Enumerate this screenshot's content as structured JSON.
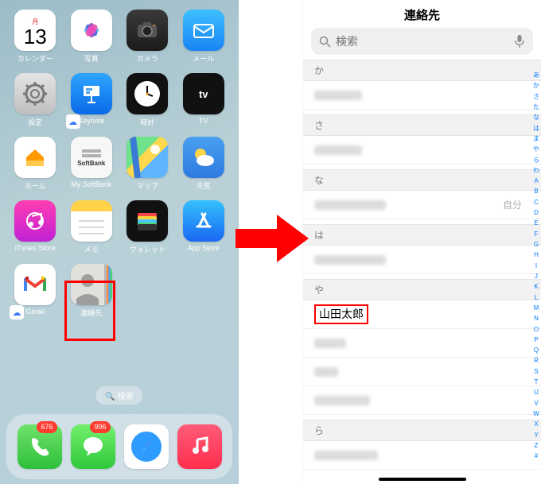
{
  "home": {
    "calendar": {
      "dow": "月",
      "day": "13"
    },
    "apps": [
      {
        "key": "calendar",
        "label": "カレンダー"
      },
      {
        "key": "photos",
        "label": "写真"
      },
      {
        "key": "camera",
        "label": "カメラ"
      },
      {
        "key": "mail",
        "label": "メール"
      },
      {
        "key": "settings",
        "label": "設定"
      },
      {
        "key": "keynote",
        "label": "Keynote"
      },
      {
        "key": "clock",
        "label": "時計"
      },
      {
        "key": "tv",
        "label": "TV"
      },
      {
        "key": "homeapp",
        "label": "ホーム"
      },
      {
        "key": "softbank",
        "label": "My SoftBank"
      },
      {
        "key": "maps",
        "label": "マップ"
      },
      {
        "key": "weather",
        "label": "天気"
      },
      {
        "key": "itunes",
        "label": "iTunes Store"
      },
      {
        "key": "notes",
        "label": "メモ"
      },
      {
        "key": "wallet",
        "label": "ウォレット"
      },
      {
        "key": "appstore",
        "label": "App Store"
      },
      {
        "key": "gmail",
        "label": "Gmail"
      },
      {
        "key": "contacts",
        "label": "連絡先"
      }
    ],
    "tv_text": "tv",
    "softbank_line1": "SoftBank",
    "search_pill": "検索",
    "dock": {
      "phone_badge": "676",
      "msg_badge": "996"
    }
  },
  "contacts": {
    "title": "連絡先",
    "search_placeholder": "検索",
    "self_label": "自分",
    "sections": {
      "ka": "か",
      "sa": "さ",
      "na": "な",
      "ha": "は",
      "ya": "や",
      "ra": "ら"
    },
    "highlighted_name": "山田太郎",
    "index": [
      "あ",
      "か",
      "さ",
      "た",
      "な",
      "は",
      "ま",
      "や",
      "ら",
      "わ",
      "A",
      "B",
      "C",
      "D",
      "E",
      "F",
      "G",
      "H",
      "I",
      "J",
      "K",
      "L",
      "M",
      "N",
      "O",
      "P",
      "Q",
      "R",
      "S",
      "T",
      "U",
      "V",
      "W",
      "X",
      "Y",
      "Z",
      "#"
    ]
  }
}
